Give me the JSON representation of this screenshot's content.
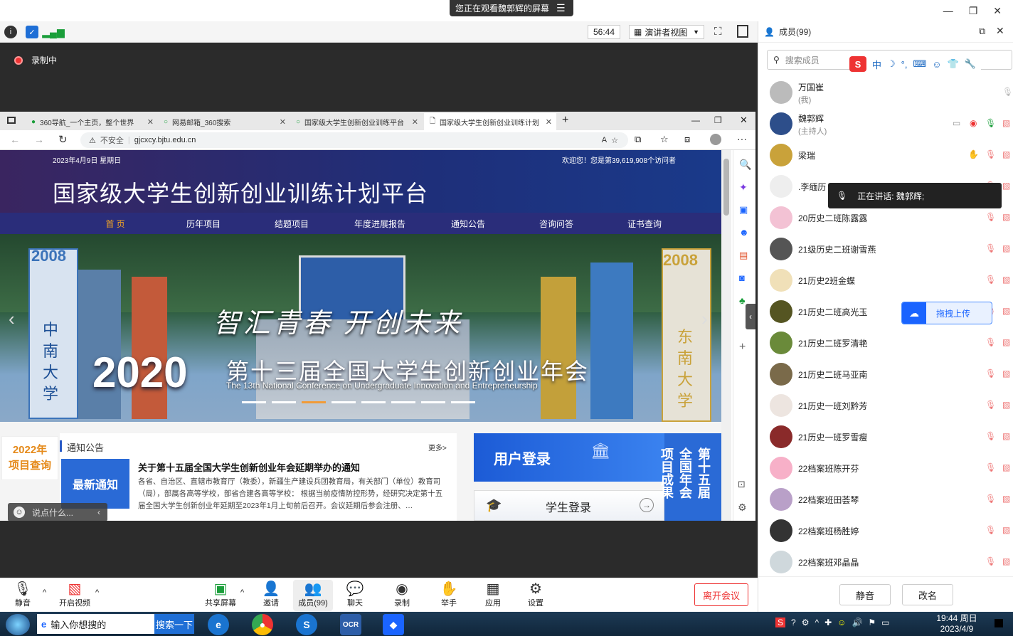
{
  "share_banner": "您正在观看魏郭辉的屏幕",
  "toolbar": {
    "timer": "56:44",
    "view_mode": "演讲者视图"
  },
  "recording": "录制中",
  "browser": {
    "tabs": [
      {
        "label": "360导航_一个主页，整个世界"
      },
      {
        "label": "网易邮箱_360搜索"
      },
      {
        "label": "国家级大学生创新创业训练平台"
      },
      {
        "label": "国家级大学生创新创业训练计划"
      }
    ],
    "insecure": "不安全",
    "url": "gjcxcy.bjtu.edu.cn"
  },
  "site": {
    "date": "2023年4月9日 星期日",
    "welcome": "欢迎您！您是第39,619,908个访问者",
    "title": "国家级大学生创新创业训练计划平台",
    "nav": [
      "首 页",
      "历年项目",
      "结题项目",
      "年度进展报告",
      "通知公告",
      "咨询问答",
      "证书查询"
    ],
    "banner": {
      "slogan": "智汇青春 开创未来",
      "year": "2020",
      "heading": "第十三届全国大学生创新创业年会",
      "subheading": "The 13th National Conference on Undergraduate Innovation and Entrepreneurship",
      "pillar_left": "中南大学",
      "pillar_right": "东南大学",
      "pillar_year_left": "2008",
      "pillar_year_right": "2008"
    },
    "badge_2022_line1": "2022年",
    "badge_2022_line2": "项目查询",
    "notice_section": "通知公告",
    "more": "更多>",
    "latest_notice": "最新通知",
    "notice_title": "关于第十五届全国大学生创新创业年会延期举办的通知",
    "notice_body": "各省、自治区、直辖市教育厅（教委），新疆生产建设兵团教育局，有关部门（单位）教育司（局），部属各高等学校，部省合建各高等学校： 根据当前疫情防控形势，经研究决定第十五届全国大学生创新创业年延期至2023年1月上旬前后召开。会议延期后参会注册、…",
    "user_login": "用户登录",
    "student_login": "学生登录",
    "vertical_text": "第十五届全国年会项目成果",
    "chat_placeholder": "说点什么..."
  },
  "bottom_bar": {
    "mute": "静音",
    "video": "开启视频",
    "share": "共享屏幕",
    "invite": "邀请",
    "members": "成员(99)",
    "chat": "聊天",
    "record": "录制",
    "raise_hand": "举手",
    "apps": "应用",
    "settings": "设置",
    "leave": "离开会议"
  },
  "panel": {
    "title": "成员(99)",
    "search_placeholder": "搜索成员",
    "ime": "中",
    "members": [
      {
        "name": "万国崔",
        "sub": "(我)"
      },
      {
        "name": "魏郭辉",
        "sub": "(主持人)"
      },
      {
        "name": "梁瑞",
        "sub": ""
      },
      {
        "name": ".李缅历",
        "sub": ""
      },
      {
        "name": "20历史二班陈露露",
        "sub": ""
      },
      {
        "name": "21级历史二班谢雪燕",
        "sub": ""
      },
      {
        "name": "21历史2班金蝶",
        "sub": ""
      },
      {
        "name": "21历史二班高光玉",
        "sub": ""
      },
      {
        "name": "21历史二班罗清艳",
        "sub": ""
      },
      {
        "name": "21历史二班马亚南",
        "sub": ""
      },
      {
        "name": "21历史一班刘黔芳",
        "sub": ""
      },
      {
        "name": "21历史一班罗雪瘦",
        "sub": ""
      },
      {
        "name": "22档案班陈开芬",
        "sub": ""
      },
      {
        "name": "22档案班田荟琴",
        "sub": ""
      },
      {
        "name": "22档案班杨胜婷",
        "sub": ""
      },
      {
        "name": "22档案班邓晶晶",
        "sub": ""
      }
    ],
    "speaking": "正在讲话: 魏郭辉;",
    "drag_upload": "拖拽上传",
    "mute_all": "静音",
    "rename": "改名"
  },
  "taskbar": {
    "search_text": "输入你想搜的",
    "search_button": "搜索一下",
    "time": "19:44 周日",
    "date": "2023/4/9"
  }
}
